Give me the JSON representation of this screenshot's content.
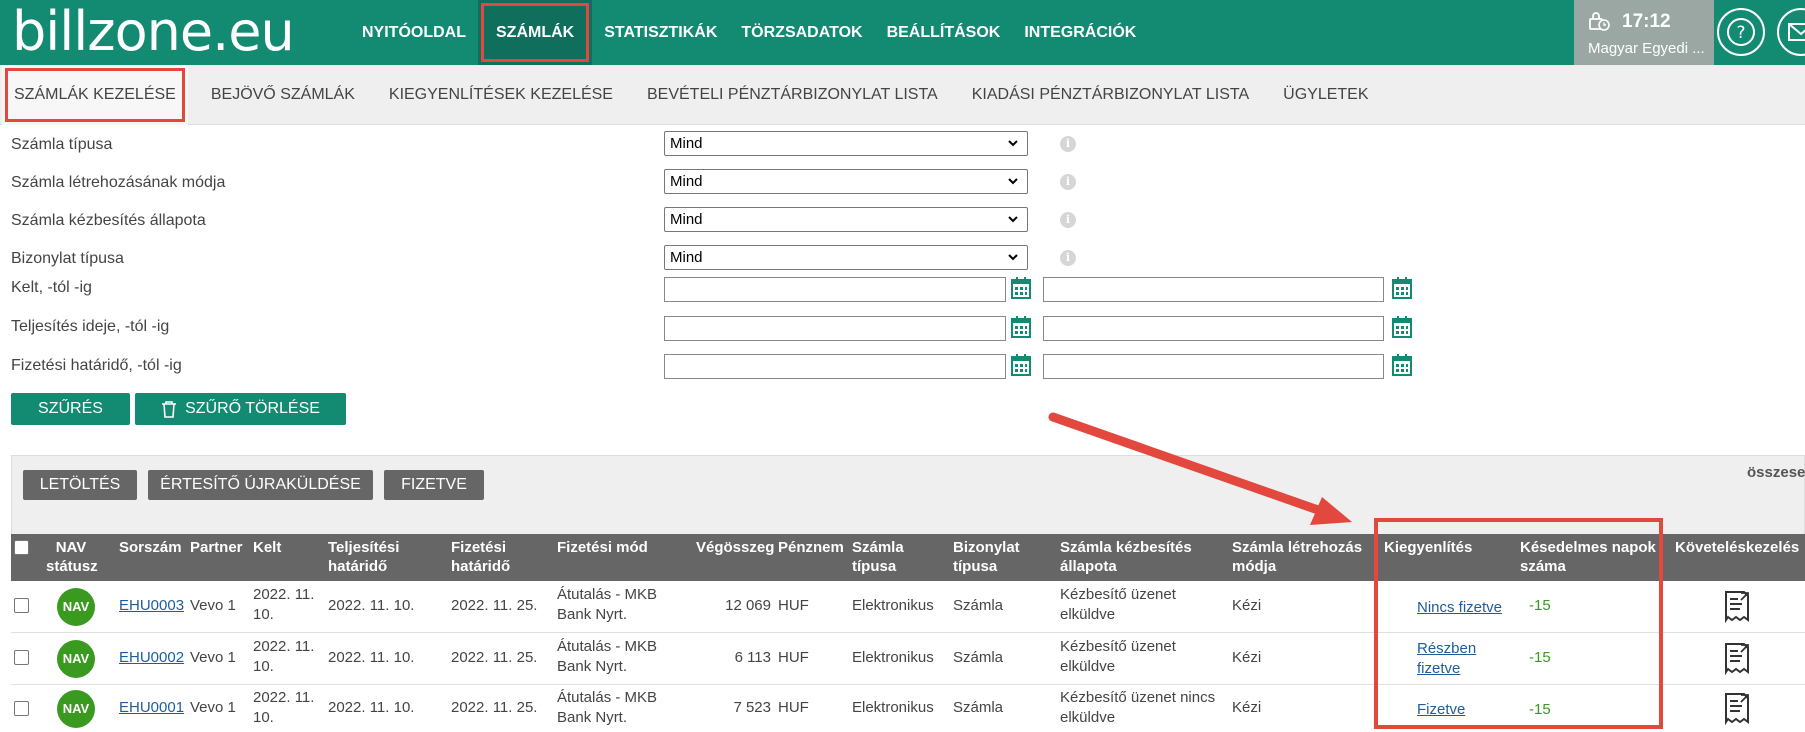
{
  "app": {
    "logo": "billzone.eu",
    "nav": [
      "NYITÓOLDAL",
      "SZÁMLÁK",
      "STATISZTIKÁK",
      "TÖRZSADATOK",
      "BEÁLLÍTÁSOK",
      "INTEGRÁCIÓK"
    ],
    "active_nav": "SZÁMLÁK",
    "time": "17:12",
    "user": "Magyar Egyedi ..."
  },
  "subnav": [
    "SZÁMLÁK KEZELÉSE",
    "BEJÖVŐ SZÁMLÁK",
    "KIEGYENLÍTÉSEK KEZELÉSE",
    "BEVÉTELI PÉNZTÁRBIZONYLAT LISTA",
    "KIADÁSI PÉNZTÁRBIZONYLAT LISTA",
    "ÜGYLETEK"
  ],
  "filters": {
    "invoice_type_label": "Számla típusa",
    "invoice_type_value": "Mind",
    "creation_mode_label": "Számla létrehozásának módja",
    "creation_mode_value": "Mind",
    "delivery_status_label": "Számla kézbesítés állapota",
    "delivery_status_value": "Mind",
    "document_type_label": "Bizonylat típusa",
    "document_type_value": "Mind",
    "issue_date_label": "Kelt, -tól -ig",
    "performance_date_label": "Teljesítés ideje, -tól -ig",
    "due_date_label": "Fizetési határidő, -tól -ig",
    "filter_button": "SZŰRÉS",
    "clear_button": "SZŰRŐ TÖRLÉSE"
  },
  "actions": {
    "download": "LETÖLTÉS",
    "resend": "ÉRTESÍTŐ ÚJRAKÜLDÉSE",
    "paid": "FIZETVE",
    "summary": "összese"
  },
  "table": {
    "headers": {
      "nav": [
        "NAV",
        "státusz"
      ],
      "number": "Sorszám",
      "partner": "Partner",
      "issued": "Kelt",
      "performance": [
        "Teljesítési",
        "határidő"
      ],
      "due": [
        "Fizetési",
        "határidő"
      ],
      "method": "Fizetési mód",
      "total": "Végösszeg",
      "currency": "Pénznem",
      "type": [
        "Számla",
        "típusa"
      ],
      "doctype": [
        "Bizonylat",
        "típusa"
      ],
      "delivery": [
        "Számla kézbesítés",
        "állapota"
      ],
      "creation": [
        "Számla létrehozás",
        "módja"
      ],
      "settlement": "Kiegyenlítés",
      "late_days": [
        "Késedelmes napok",
        "száma"
      ],
      "collection": "Követeléskezelés"
    },
    "rows": [
      {
        "nav": "NAV",
        "number": "EHU0003",
        "partner": "Vevo 1",
        "issued": [
          "2022. 11.",
          "10."
        ],
        "performance": "2022. 11. 10.",
        "due": "2022. 11. 25.",
        "method": [
          "Átutalás - MKB",
          "Bank Nyrt."
        ],
        "total": "12 069",
        "currency": "HUF",
        "type": "Elektronikus",
        "doctype": "Számla",
        "delivery": [
          "Kézbesítő üzenet",
          "elküldve"
        ],
        "creation": "Kézi",
        "settlement": [
          "Nincs fizetve"
        ],
        "late_days": "-15"
      },
      {
        "nav": "NAV",
        "number": "EHU0002",
        "partner": "Vevo 1",
        "issued": [
          "2022. 11.",
          "10."
        ],
        "performance": "2022. 11. 10.",
        "due": "2022. 11. 25.",
        "method": [
          "Átutalás - MKB",
          "Bank Nyrt."
        ],
        "total": "6 113",
        "currency": "HUF",
        "type": "Elektronikus",
        "doctype": "Számla",
        "delivery": [
          "Kézbesítő üzenet",
          "elküldve"
        ],
        "creation": "Kézi",
        "settlement": [
          "Részben",
          "fizetve"
        ],
        "late_days": "-15"
      },
      {
        "nav": "NAV",
        "number": "EHU0001",
        "partner": "Vevo 1",
        "issued": [
          "2022. 11.",
          "10."
        ],
        "performance": "2022. 11. 10.",
        "due": "2022. 11. 25.",
        "method": [
          "Átutalás - MKB",
          "Bank Nyrt."
        ],
        "total": "7 523",
        "currency": "HUF",
        "type": "Elektronikus",
        "doctype": "Számla",
        "delivery": [
          "Kézbesítő üzenet nincs",
          "elküldve"
        ],
        "creation": "Kézi",
        "settlement": [
          "Fizetve"
        ],
        "late_days": "-15"
      }
    ]
  },
  "colors": {
    "brand": "#138a72",
    "highlight": "#e2483d",
    "nav_badge": "#3a9a1f"
  }
}
